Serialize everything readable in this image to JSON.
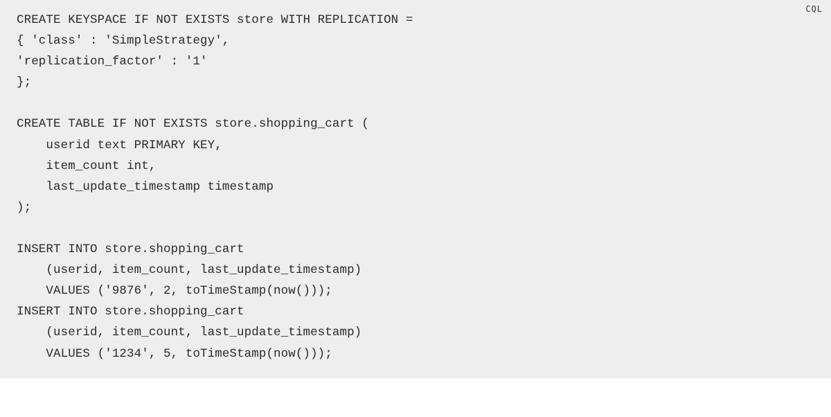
{
  "code_block": {
    "language_label": "CQL",
    "lines": [
      "CREATE KEYSPACE IF NOT EXISTS store WITH REPLICATION =",
      "{ 'class' : 'SimpleStrategy',",
      "'replication_factor' : '1'",
      "};",
      "",
      "CREATE TABLE IF NOT EXISTS store.shopping_cart (",
      "    userid text PRIMARY KEY,",
      "    item_count int,",
      "    last_update_timestamp timestamp",
      ");",
      "",
      "INSERT INTO store.shopping_cart",
      "    (userid, item_count, last_update_timestamp)",
      "    VALUES ('9876', 2, toTimeStamp(now()));",
      "INSERT INTO store.shopping_cart",
      "    (userid, item_count, last_update_timestamp)",
      "    VALUES ('1234', 5, toTimeStamp(now()));"
    ]
  }
}
